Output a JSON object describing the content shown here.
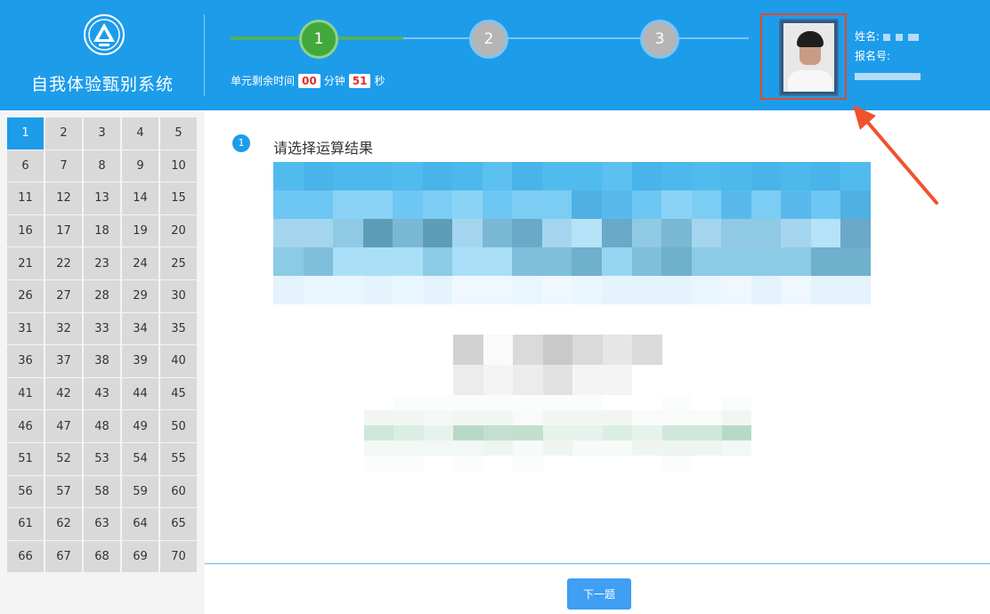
{
  "app": {
    "title": "自我体验甄别系统"
  },
  "steps": [
    "1",
    "2",
    "3"
  ],
  "current_step": 1,
  "timer": {
    "prefix": "单元剩余时间",
    "minutes": "00",
    "minutes_unit": "分钟",
    "seconds": "51",
    "seconds_unit": "秒"
  },
  "candidate": {
    "name_label": "姓名:",
    "id_label": "报名号:"
  },
  "question_nav": {
    "current": "1",
    "numbers": [
      "1",
      "2",
      "3",
      "4",
      "5",
      "6",
      "7",
      "8",
      "9",
      "10",
      "11",
      "12",
      "13",
      "14",
      "15",
      "16",
      "17",
      "18",
      "19",
      "20",
      "21",
      "22",
      "23",
      "24",
      "25",
      "26",
      "27",
      "28",
      "29",
      "30",
      "31",
      "32",
      "33",
      "34",
      "35",
      "36",
      "37",
      "38",
      "39",
      "40",
      "41",
      "42",
      "43",
      "44",
      "45",
      "46",
      "47",
      "48",
      "49",
      "50",
      "51",
      "52",
      "53",
      "54",
      "55",
      "56",
      "57",
      "58",
      "59",
      "60",
      "61",
      "62",
      "63",
      "64",
      "65",
      "66",
      "67",
      "68",
      "69",
      "70"
    ]
  },
  "question": {
    "number": "1",
    "prompt": "请选择运算结果"
  },
  "actions": {
    "next_label": "下一题"
  },
  "colors": {
    "header_bg": "#1d9cea",
    "step_active": "#43a83b",
    "step_todo": "#b5b5b5",
    "progress_done": "#52b15b",
    "current_question": "#1d9cea",
    "timer_digits": "#e02c2c",
    "highlight_border": "#e04a2a",
    "arrow": "#f0522c"
  }
}
